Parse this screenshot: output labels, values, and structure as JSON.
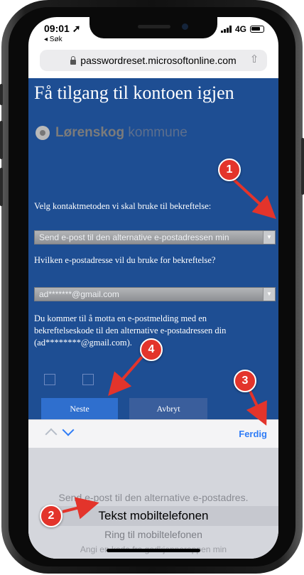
{
  "status_bar": {
    "time": "09:01",
    "back_label": "◂ Søk",
    "network": "4G"
  },
  "browser": {
    "url": "passwordreset.microsoftonline.com"
  },
  "page": {
    "title": "Få tilgang til kontoen igjen",
    "logo_bold": "Lørenskog",
    "logo_light": "kommune",
    "contact_method_label": "Velg kontaktmetoden vi skal bruke til bekreftelse:",
    "contact_method_value": "Send e-post til den alternative e-postadressen min",
    "email_question": "Hvilken e-postadresse vil du bruke for bekreftelse?",
    "email_value": "ad*******@gmail.com",
    "info_text": "Du kommer til å motta en e-postmelding med en bekreftelseskode til den alternative e-postadressen din (ad********@gmail.com).",
    "next_button": "Neste",
    "cancel_button": "Avbryt"
  },
  "picker": {
    "done_label": "Ferdig",
    "options": [
      "Send e-post til den alternative e-postadres.",
      "Tekst mobiltelefonen",
      "Ring til mobiltelefonen",
      "Angi en kode fra godkjennerappen min"
    ],
    "selected_index": 1
  },
  "annotations": [
    "1",
    "2",
    "3",
    "4"
  ],
  "colors": {
    "panel_blue": "#1e4e93",
    "button_blue": "#2f6fce",
    "annotation_red": "#e3342b",
    "ios_blue": "#2f7cf6"
  }
}
